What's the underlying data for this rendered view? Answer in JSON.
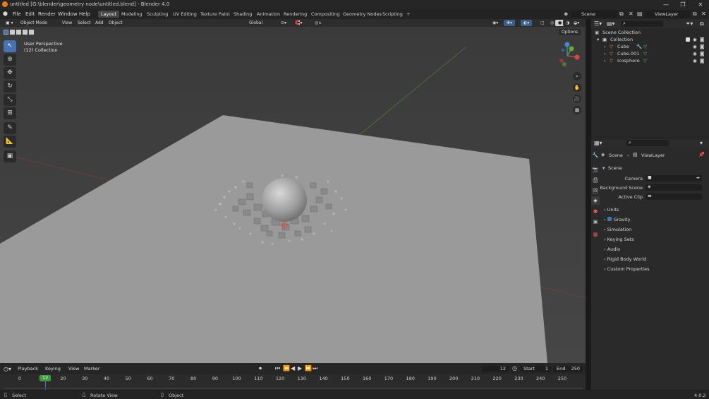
{
  "window": {
    "title": "untitled [G:\\blender\\geometry node\\untitled.blend] - Blender 4.0",
    "controls": [
      "—",
      "❐",
      "✕"
    ]
  },
  "menubar": {
    "items": [
      "File",
      "Edit",
      "Render",
      "Window",
      "Help"
    ],
    "workspaces": [
      "Layout",
      "Modeling",
      "Sculpting",
      "UV Editing",
      "Texture Paint",
      "Shading",
      "Animation",
      "Rendering",
      "Compositing",
      "Geometry Nodes",
      "Scripting"
    ],
    "active_workspace": "Layout",
    "add_workspace": "+",
    "scene": "Scene",
    "view_layer": "ViewLayer"
  },
  "viewport": {
    "mode": "Object Mode",
    "menus": [
      "View",
      "Select",
      "Add",
      "Object"
    ],
    "transform_orientation": "Global",
    "options_label": "Options",
    "overlay_line1": "User Perspective",
    "overlay_line2": "(12) Collection",
    "gizmo_axes": [
      "X",
      "Y",
      "Z"
    ],
    "bg_color": "#3d3d3d",
    "plane_color": "#9a9a9a"
  },
  "outliner": {
    "root": "Scene Collection",
    "collection": "Collection",
    "objects": [
      "Cube",
      "Cube.001",
      "Icosphere"
    ]
  },
  "properties": {
    "breadcrumb_scene": "Scene",
    "breadcrumb_layer": "ViewLayer",
    "panel_title": "Scene",
    "fields": [
      {
        "label": "Camera"
      },
      {
        "label": "Background Scene"
      },
      {
        "label": "Active Clip"
      }
    ],
    "sections": [
      "Units",
      "Gravity",
      "Simulation",
      "Keying Sets",
      "Audio",
      "Rigid Body World",
      "Custom Properties"
    ]
  },
  "timeline": {
    "menus": [
      "Playback",
      "Keying",
      "View",
      "Marker"
    ],
    "current_frame": "12",
    "start_label": "Start",
    "start_value": "1",
    "end_label": "End",
    "end_value": "250",
    "ticks": [
      "0",
      "10",
      "20",
      "30",
      "40",
      "50",
      "60",
      "70",
      "80",
      "90",
      "100",
      "110",
      "120",
      "130",
      "140",
      "150",
      "160",
      "170",
      "180",
      "190",
      "200",
      "210",
      "220",
      "230",
      "240",
      "250"
    ],
    "playhead_label": "12"
  },
  "statusbar": {
    "select": "Select",
    "rotate": "Rotate View",
    "object": "Object",
    "version": "4.0.2"
  }
}
